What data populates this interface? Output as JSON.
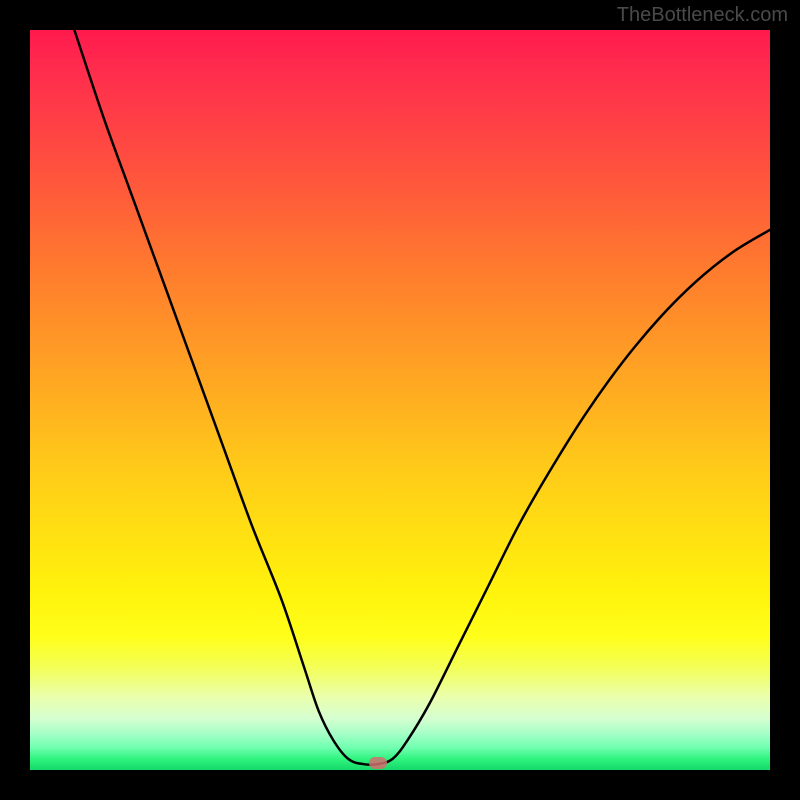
{
  "watermark": "TheBottleneck.com",
  "chart_data": {
    "type": "line",
    "title": "",
    "xlabel": "",
    "ylabel": "",
    "xlim": [
      0,
      100
    ],
    "ylim": [
      0,
      100
    ],
    "grid": false,
    "curve_points": [
      {
        "x": 6,
        "y": 100
      },
      {
        "x": 10,
        "y": 88
      },
      {
        "x": 14,
        "y": 77
      },
      {
        "x": 18,
        "y": 66
      },
      {
        "x": 22,
        "y": 55
      },
      {
        "x": 26,
        "y": 44
      },
      {
        "x": 30,
        "y": 33
      },
      {
        "x": 34,
        "y": 23
      },
      {
        "x": 37,
        "y": 14
      },
      {
        "x": 39,
        "y": 8
      },
      {
        "x": 41,
        "y": 4
      },
      {
        "x": 43,
        "y": 1.5
      },
      {
        "x": 45,
        "y": 0.8
      },
      {
        "x": 47,
        "y": 0.8
      },
      {
        "x": 49,
        "y": 1.5
      },
      {
        "x": 51,
        "y": 4
      },
      {
        "x": 54,
        "y": 9
      },
      {
        "x": 58,
        "y": 17
      },
      {
        "x": 62,
        "y": 25
      },
      {
        "x": 66,
        "y": 33
      },
      {
        "x": 70,
        "y": 40
      },
      {
        "x": 75,
        "y": 48
      },
      {
        "x": 80,
        "y": 55
      },
      {
        "x": 85,
        "y": 61
      },
      {
        "x": 90,
        "y": 66
      },
      {
        "x": 95,
        "y": 70
      },
      {
        "x": 100,
        "y": 73
      }
    ],
    "marker": {
      "x": 47,
      "y": 1
    },
    "colors": {
      "top": "#ff1a4d",
      "mid": "#fff30c",
      "bottom": "#14d96a",
      "curve": "#000000",
      "marker": "#d26f6f"
    }
  }
}
